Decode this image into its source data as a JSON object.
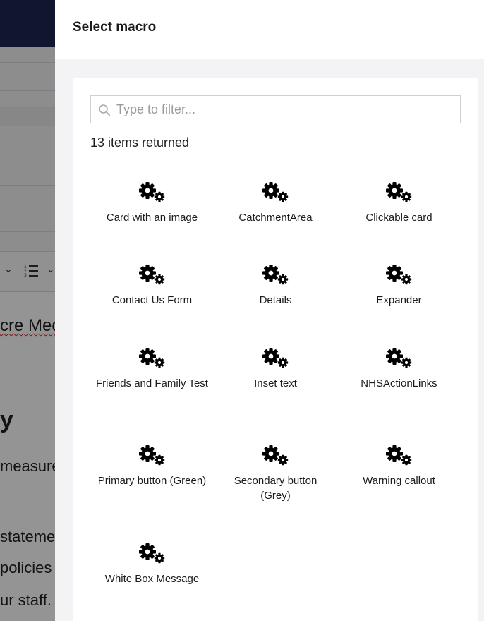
{
  "background": {
    "snippets": {
      "line1": "cre Medi",
      "line2": "y",
      "line3": "measure",
      "line4": "stateme",
      "line5": " policies",
      "line6": "ur staff."
    }
  },
  "dialog": {
    "title": "Select macro",
    "search": {
      "placeholder": "Type to filter...",
      "value": ""
    },
    "count_text": "13 items returned",
    "items": [
      {
        "label": "Card with an image",
        "icon": "cogs-icon"
      },
      {
        "label": "CatchmentArea",
        "icon": "cogs-icon"
      },
      {
        "label": "Clickable card",
        "icon": "cogs-icon"
      },
      {
        "label": "Contact Us Form",
        "icon": "cogs-icon"
      },
      {
        "label": "Details",
        "icon": "cogs-icon"
      },
      {
        "label": "Expander",
        "icon": "cogs-icon"
      },
      {
        "label": "Friends and Family Test",
        "icon": "cogs-icon"
      },
      {
        "label": "Inset text",
        "icon": "cogs-icon"
      },
      {
        "label": "NHSActionLinks",
        "icon": "cogs-icon"
      },
      {
        "label": "Primary button (Green)",
        "icon": "cogs-icon"
      },
      {
        "label": "Secondary button (Grey)",
        "icon": "cogs-icon"
      },
      {
        "label": "Warning callout",
        "icon": "cogs-icon"
      },
      {
        "label": "White Box Message",
        "icon": "cogs-icon"
      }
    ]
  },
  "colors": {
    "topbar": "#1b264f",
    "overlay": "rgba(0,0,0,0.42)",
    "panel_bg": "#f3f3f5",
    "text": "#1b1b1b",
    "icon": "#000000"
  }
}
